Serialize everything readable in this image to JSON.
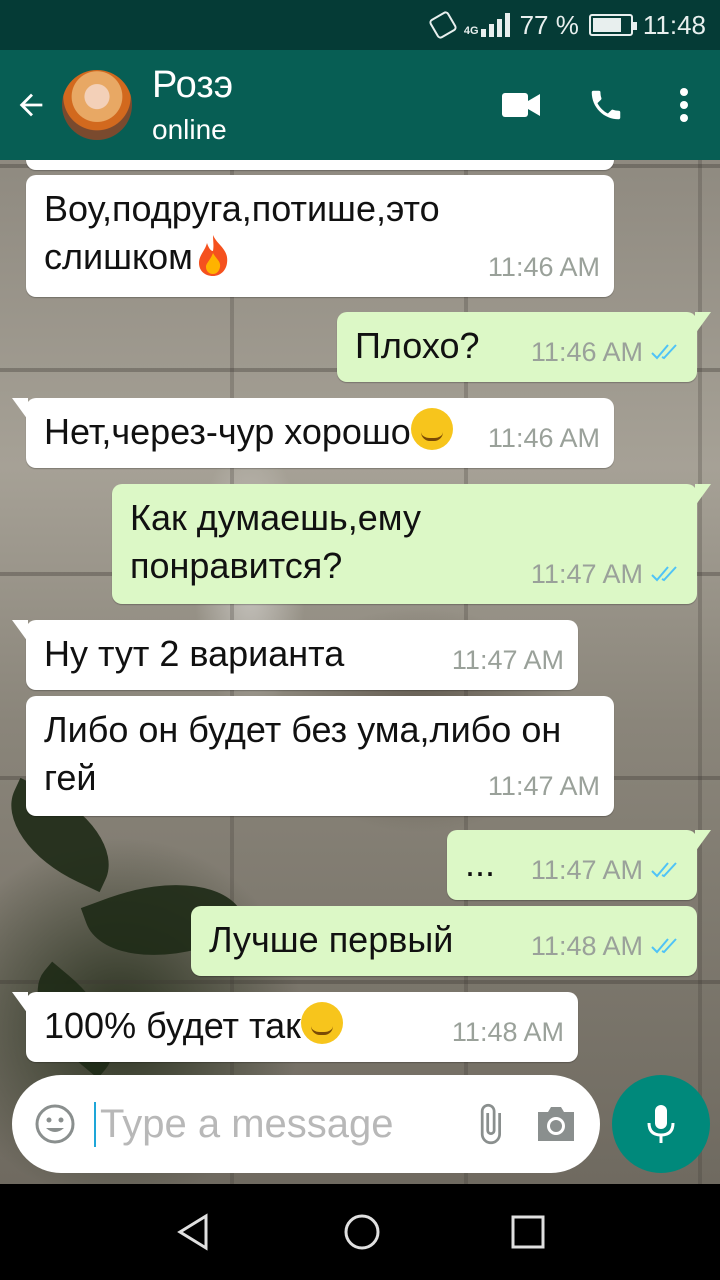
{
  "status_bar": {
    "network": "4G",
    "battery": "77 %",
    "battery_level": 0.77,
    "time": "11:48"
  },
  "header": {
    "contact_name": "Розэ",
    "presence": "online"
  },
  "messages": [
    {
      "direction": "in",
      "text": "Воу,подруга,потише,это слишком",
      "emoji": "fire",
      "time": "11:46 AM",
      "read": false
    },
    {
      "direction": "out",
      "text": "Плохо?",
      "time": "11:46 AM",
      "read": true
    },
    {
      "direction": "in",
      "text": "Нет,через-чур хорошо",
      "emoji": "smirk",
      "time": "11:46 AM",
      "read": false
    },
    {
      "direction": "out",
      "text": "Как думаешь,ему понравится?",
      "time": "11:47 AM",
      "read": true
    },
    {
      "direction": "in",
      "text": "Ну тут 2 варианта",
      "time": "11:47 AM",
      "read": false
    },
    {
      "direction": "in",
      "text": "Либо он будет без ума,либо он гей",
      "time": "11:47 AM",
      "read": false
    },
    {
      "direction": "out",
      "text": "...",
      "time": "11:47 AM",
      "read": true
    },
    {
      "direction": "out",
      "text": "Лучше первый",
      "time": "11:48 AM",
      "read": true
    },
    {
      "direction": "in",
      "text": "100% будет так",
      "emoji": "smirk",
      "time": "11:48 AM",
      "read": false
    }
  ],
  "composer": {
    "placeholder": "Type a message"
  },
  "icons": {
    "back": "arrow-left-icon",
    "video": "video-call-icon",
    "call": "phone-icon",
    "menu": "more-vert-icon",
    "emoji": "emoji-icon",
    "attach": "paperclip-icon",
    "camera": "camera-icon",
    "mic": "mic-icon"
  },
  "colors": {
    "header": "#075e54",
    "status_bar": "#053b36",
    "outgoing_bubble": "#dcf8c6",
    "incoming_bubble": "#ffffff",
    "read_ticks": "#4fc3f7",
    "mic_button": "#00897b"
  }
}
